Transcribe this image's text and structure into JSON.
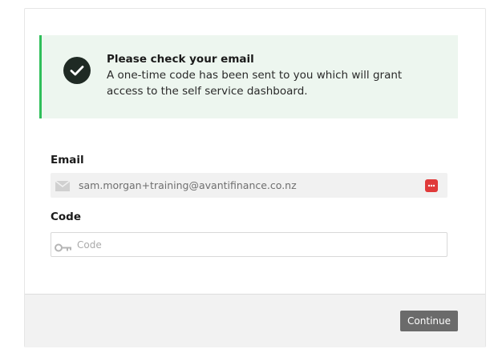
{
  "alert": {
    "title": "Please check your email",
    "message": "A one-time code has been sent to you which will grant access to the self service dashboard.",
    "icon": "check-circle-icon"
  },
  "form": {
    "email_label": "Email",
    "email_value": "sam.morgan+training@avantifinance.co.nz",
    "email_icon": "envelope-icon",
    "code_label": "Code",
    "code_placeholder": "Code",
    "code_value": "",
    "code_icon": "key-icon"
  },
  "footer": {
    "continue_label": "Continue"
  },
  "colors": {
    "alert_background": "#edf6ef",
    "alert_accent": "#2fbf5a",
    "button": "#6b6b6b",
    "extension_icon": "#e03a3a"
  }
}
